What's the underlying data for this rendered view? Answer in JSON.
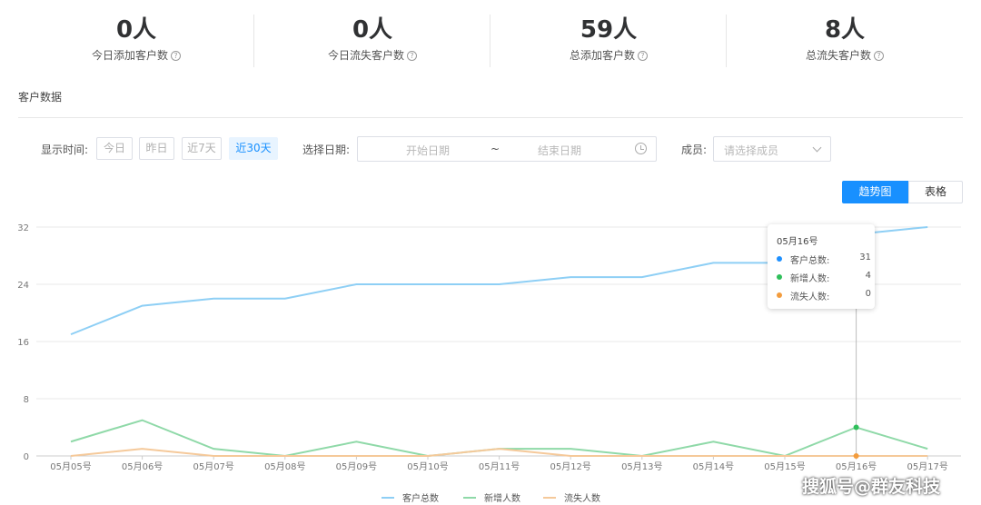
{
  "stats": [
    {
      "value": "0人",
      "label": "今日添加客户数"
    },
    {
      "value": "0人",
      "label": "今日流失客户数"
    },
    {
      "value": "59人",
      "label": "总添加客户数"
    },
    {
      "value": "8人",
      "label": "总流失客户数"
    }
  ],
  "help_icon": "?",
  "section_title": "客户数据",
  "filters": {
    "time_label": "显示时间:",
    "time_buttons": [
      "今日",
      "昨日",
      "近7天",
      "近30天"
    ],
    "active_time": "近30天",
    "date_label": "选择日期:",
    "start_placeholder": "开始日期",
    "separator": "~",
    "end_placeholder": "结束日期",
    "member_label": "成员:",
    "member_placeholder": "请选择成员"
  },
  "view_toggle": {
    "trend": "趋势图",
    "table": "表格",
    "active": "趋势图"
  },
  "tooltip": {
    "title": "05月16号",
    "rows": [
      {
        "name": "客户总数:",
        "value": "31"
      },
      {
        "name": "新增人数:",
        "value": "4"
      },
      {
        "name": "流失人数:",
        "value": "0"
      }
    ]
  },
  "colors": {
    "accent": "#1890ff",
    "total": "#8ecff5",
    "new": "#8fd9a8",
    "lost": "#f5c99a"
  },
  "chart_data": {
    "type": "line",
    "x": [
      "05月05号",
      "05月06号",
      "05月07号",
      "05月08号",
      "05月09号",
      "05月10号",
      "05月11号",
      "05月12号",
      "05月13号",
      "05月14号",
      "05月15号",
      "05月16号",
      "05月17号"
    ],
    "yticks": [
      "0",
      "8",
      "16",
      "24",
      "32"
    ],
    "ylim": [
      0,
      32
    ],
    "grid": true,
    "legend_position": "bottom",
    "series": [
      {
        "name": "客户总数",
        "values": [
          17,
          21,
          22,
          22,
          24,
          24,
          24,
          25,
          25,
          27,
          27,
          31,
          32
        ]
      },
      {
        "name": "新增人数",
        "values": [
          2,
          5,
          1,
          0,
          2,
          0,
          1,
          1,
          0,
          2,
          0,
          4,
          1
        ]
      },
      {
        "name": "流失人数",
        "values": [
          0,
          1,
          0,
          0,
          0,
          0,
          1,
          0,
          0,
          0,
          0,
          0,
          0
        ]
      }
    ],
    "highlight_index": 11
  },
  "watermark": "搜狐号@群友科技"
}
